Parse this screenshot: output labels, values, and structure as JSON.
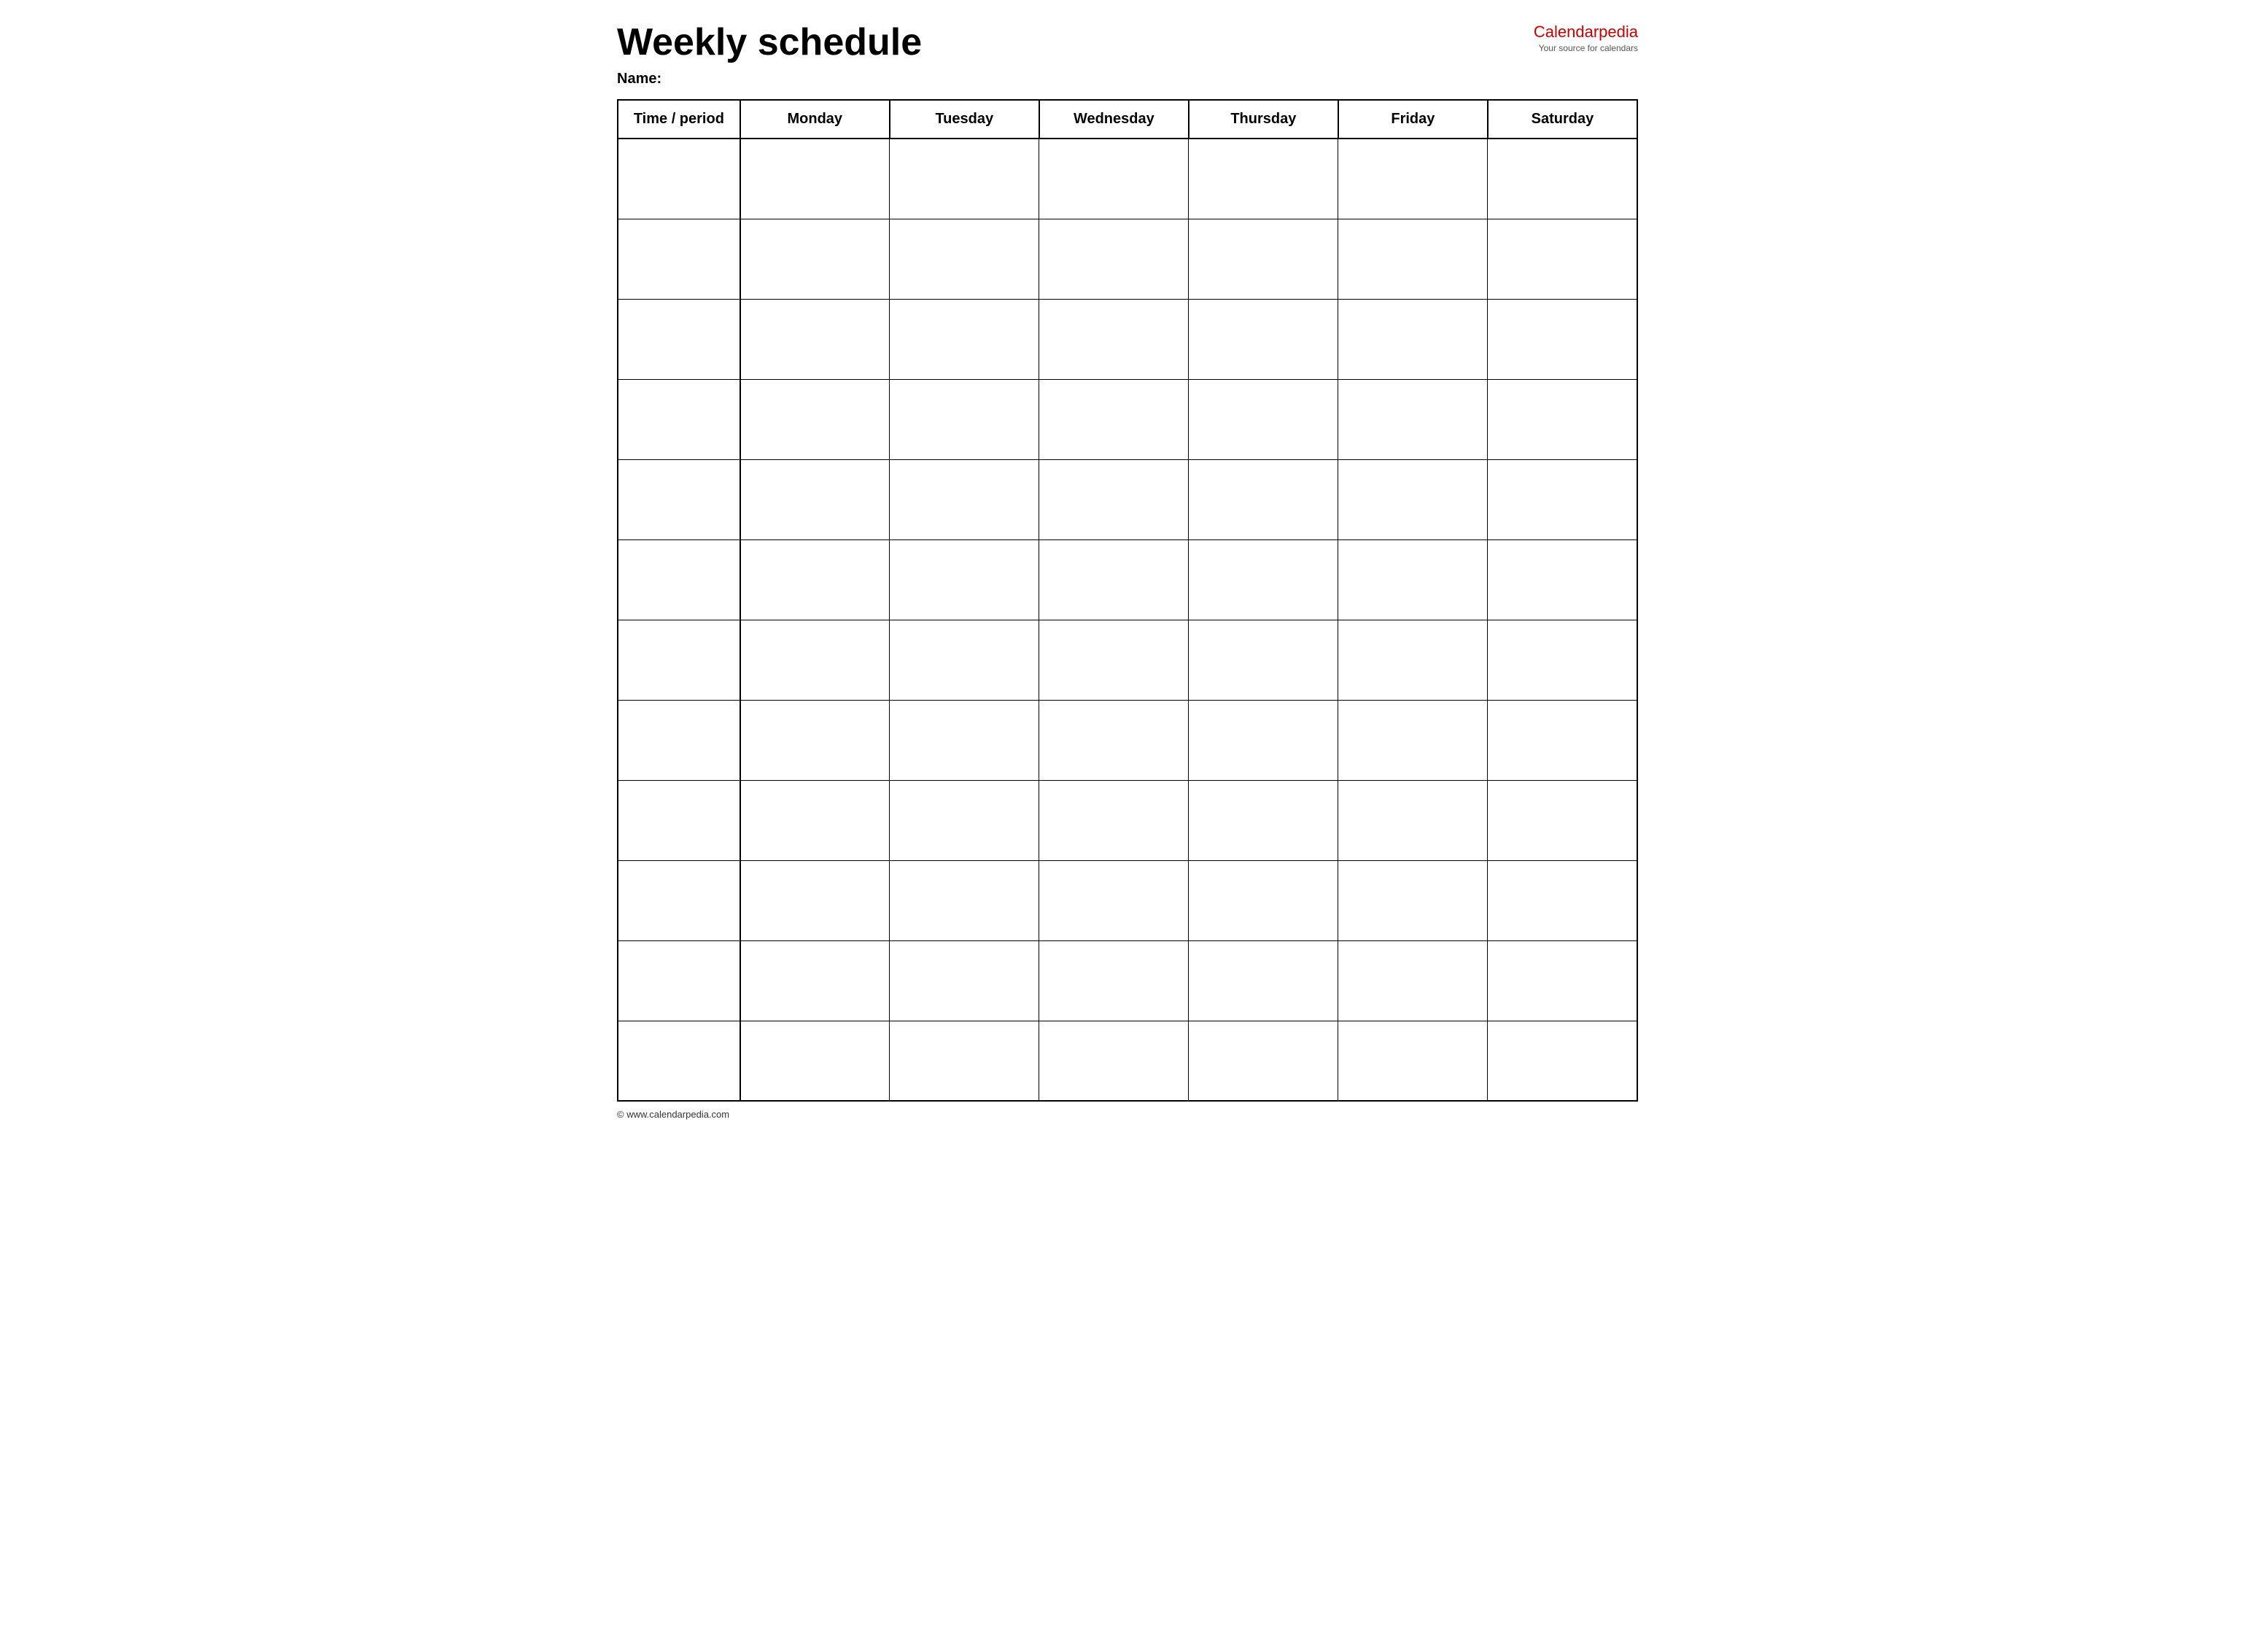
{
  "header": {
    "title": "Weekly schedule",
    "logo_main": "Calendar",
    "logo_accent": "pedia",
    "logo_tagline": "Your source for calendars"
  },
  "name_label": "Name:",
  "table": {
    "columns": [
      {
        "key": "time",
        "label": "Time / period"
      },
      {
        "key": "monday",
        "label": "Monday"
      },
      {
        "key": "tuesday",
        "label": "Tuesday"
      },
      {
        "key": "wednesday",
        "label": "Wednesday"
      },
      {
        "key": "thursday",
        "label": "Thursday"
      },
      {
        "key": "friday",
        "label": "Friday"
      },
      {
        "key": "saturday",
        "label": "Saturday"
      }
    ],
    "row_count": 12
  },
  "footer": {
    "text": "© www.calendarpedia.com"
  }
}
